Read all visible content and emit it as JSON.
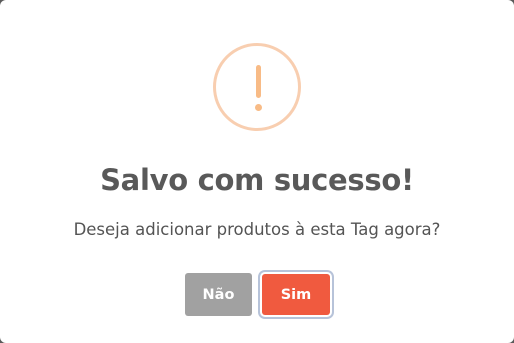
{
  "dialog": {
    "icon": "exclamation-warning-icon",
    "title": "Salvo com sucesso!",
    "message": "Deseja adicionar produtos à esta Tag agora?",
    "cancel_label": "Não",
    "confirm_label": "Sim"
  },
  "colors": {
    "icon_ring": "#f8ceb0",
    "icon_mark": "#f8bb86",
    "cancel_button": "#a1a1a1",
    "confirm_button": "#f05a3f",
    "title_text": "#595959"
  }
}
